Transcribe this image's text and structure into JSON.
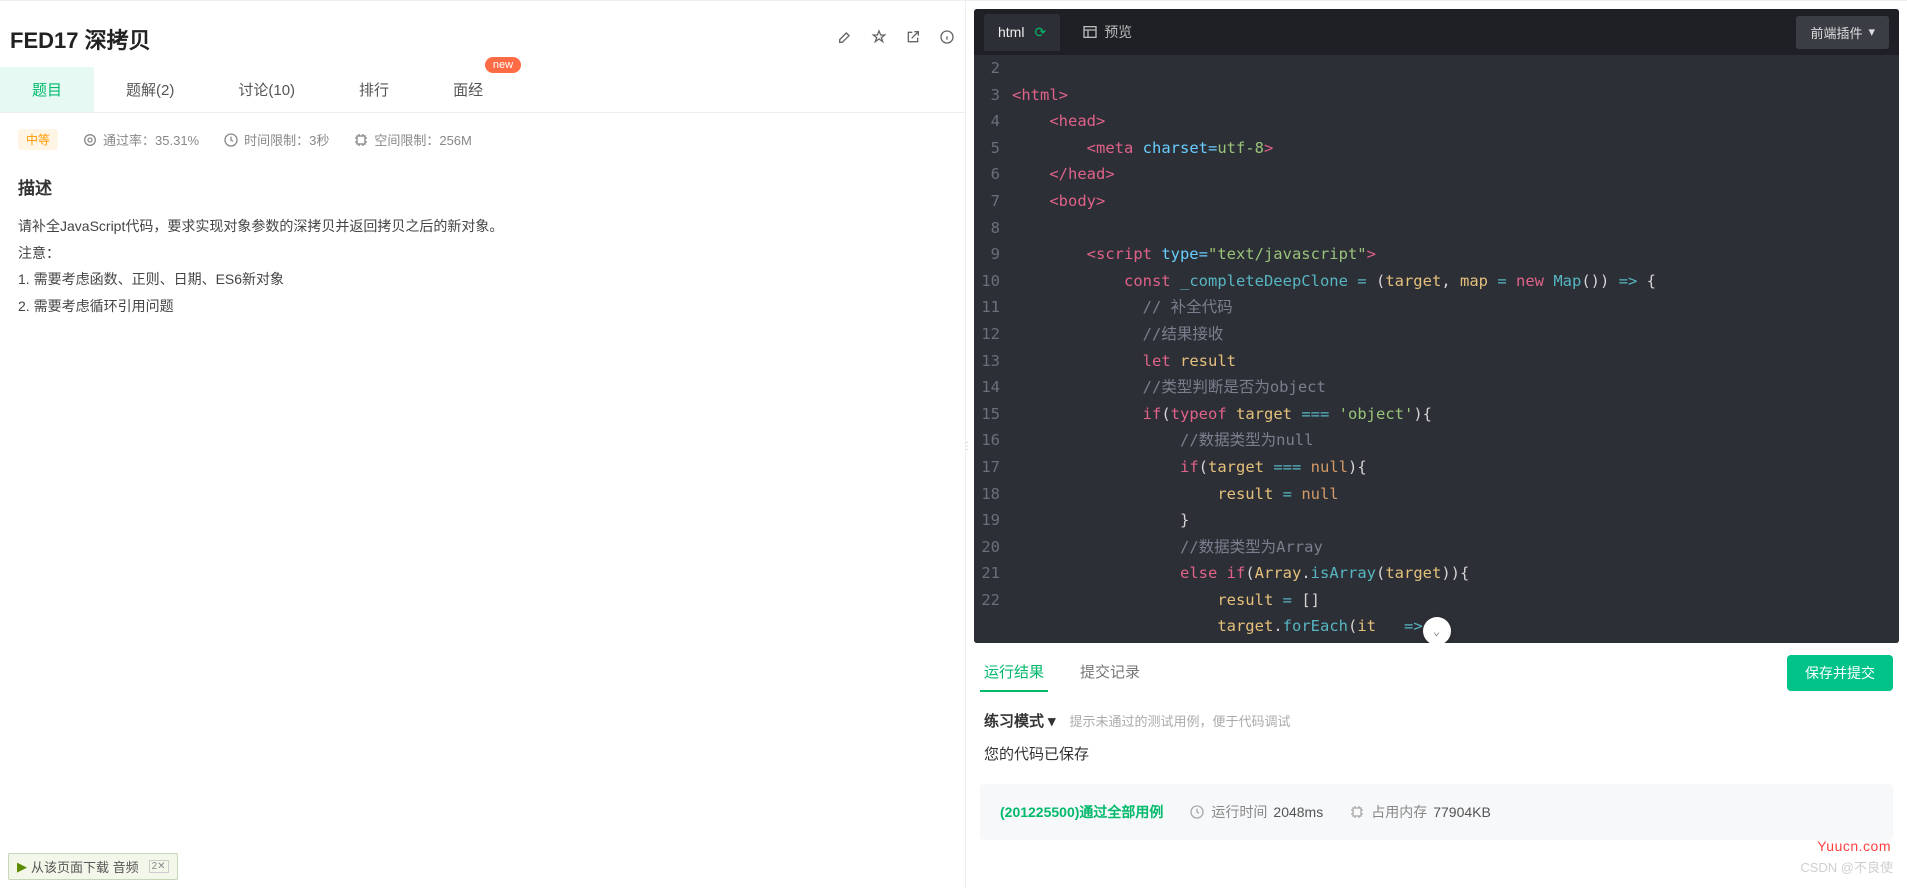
{
  "problem": {
    "title": "FED17  深拷贝"
  },
  "tabs": [
    {
      "label": "题目",
      "active": true
    },
    {
      "label": "题解(2)"
    },
    {
      "label": "讨论(10)"
    },
    {
      "label": "排行"
    },
    {
      "label": "面经",
      "badge": "new"
    }
  ],
  "meta": {
    "difficulty": "中等",
    "pass_rate_label": "通过率：35.31%",
    "time_limit_label": "时间限制：3秒",
    "mem_limit_label": "空间限制：256M"
  },
  "description": {
    "heading": "描述",
    "intro": "请补全JavaScript代码，要求实现对象参数的深拷贝并返回拷贝之后的新对象。",
    "note_label": "注意：",
    "note1": "1. 需要考虑函数、正则、日期、ES6新对象",
    "note2": "2. 需要考虑循环引用问题"
  },
  "download_bar": {
    "text": "从该页面下载 音频",
    "close": "2✕"
  },
  "editor": {
    "tab_label": "html",
    "preview_label": "预览",
    "plugin_label": "前端插件",
    "line_start": 2,
    "line_end": 22
  },
  "code": {
    "l2": {
      "tag": "<html>"
    },
    "l3": {
      "tag": "<head>"
    },
    "l4": {
      "tag_open": "<meta ",
      "attr": "charset=",
      "val": "utf-8",
      "tag_close": ">"
    },
    "l5": {
      "tag": "</head>"
    },
    "l6": {
      "tag": "<body>"
    },
    "l8": {
      "tag_open": "<script ",
      "attr": "type=",
      "str": "\"text/javascript\"",
      "tag_close": ">"
    },
    "l9": {
      "kw1": "const",
      "var": " _completeDeepClone ",
      "op1": "= ",
      "pl1": "(",
      "p1": "target",
      "pl2": ", ",
      "p2": "map",
      "op2": " = ",
      "kw2": "new",
      "cls": " Map",
      "pl3": "()) ",
      "ar": "=>",
      "pl4": " {"
    },
    "l10": {
      "cmt": "// 补全代码"
    },
    "l11": {
      "cmt": "//结果接收"
    },
    "l12": {
      "kw": "let",
      "var": " result"
    },
    "l13": {
      "cmt": "//类型判断是否为object"
    },
    "l14": {
      "kw1": "if",
      "pl1": "(",
      "kw2": "typeof",
      "var": " target ",
      "op": "===",
      "str": " 'object'",
      "pl2": "){"
    },
    "l15": {
      "cmt": "//数据类型为null"
    },
    "l16": {
      "kw": "if",
      "pl1": "(",
      "var": "target ",
      "op": "===",
      "nl": " null",
      "pl2": "){"
    },
    "l17": {
      "var": "result ",
      "op": "=",
      "nl": " null"
    },
    "l18": {
      "pl": "}"
    },
    "l19": {
      "cmt": "//数据类型为Array"
    },
    "l20": {
      "kw1": "else",
      "kw2": " if",
      "pl1": "(",
      "var": "Array",
      "pl2": ".",
      "fn": "isArray",
      "pl3": "(",
      "var2": "target",
      "pl4": ")){"
    },
    "l21": {
      "var": "result ",
      "op": "=",
      "pl": " []"
    },
    "l22": {
      "var": "target",
      "pl1": ".",
      "fn": "forEach",
      "pl2": "(",
      "p": "it",
      "pl3": "   ",
      "ar": "=>",
      "pl4": " {"
    }
  },
  "results": {
    "tab_run": "运行结果",
    "tab_history": "提交记录",
    "save_submit": "保存并提交",
    "mode_label": "练习模式",
    "mode_hint": "提示未通过的测试用例，便于代码调试",
    "saved_text": "您的代码已保存",
    "pass_text": "(201225500)通过全部用例",
    "runtime_label": "运行时间",
    "runtime_value": "2048ms",
    "mem_label": "占用内存",
    "mem_value": "77904KB"
  },
  "watermark1": "Yuucn.com",
  "watermark2": "CSDN @不良使"
}
